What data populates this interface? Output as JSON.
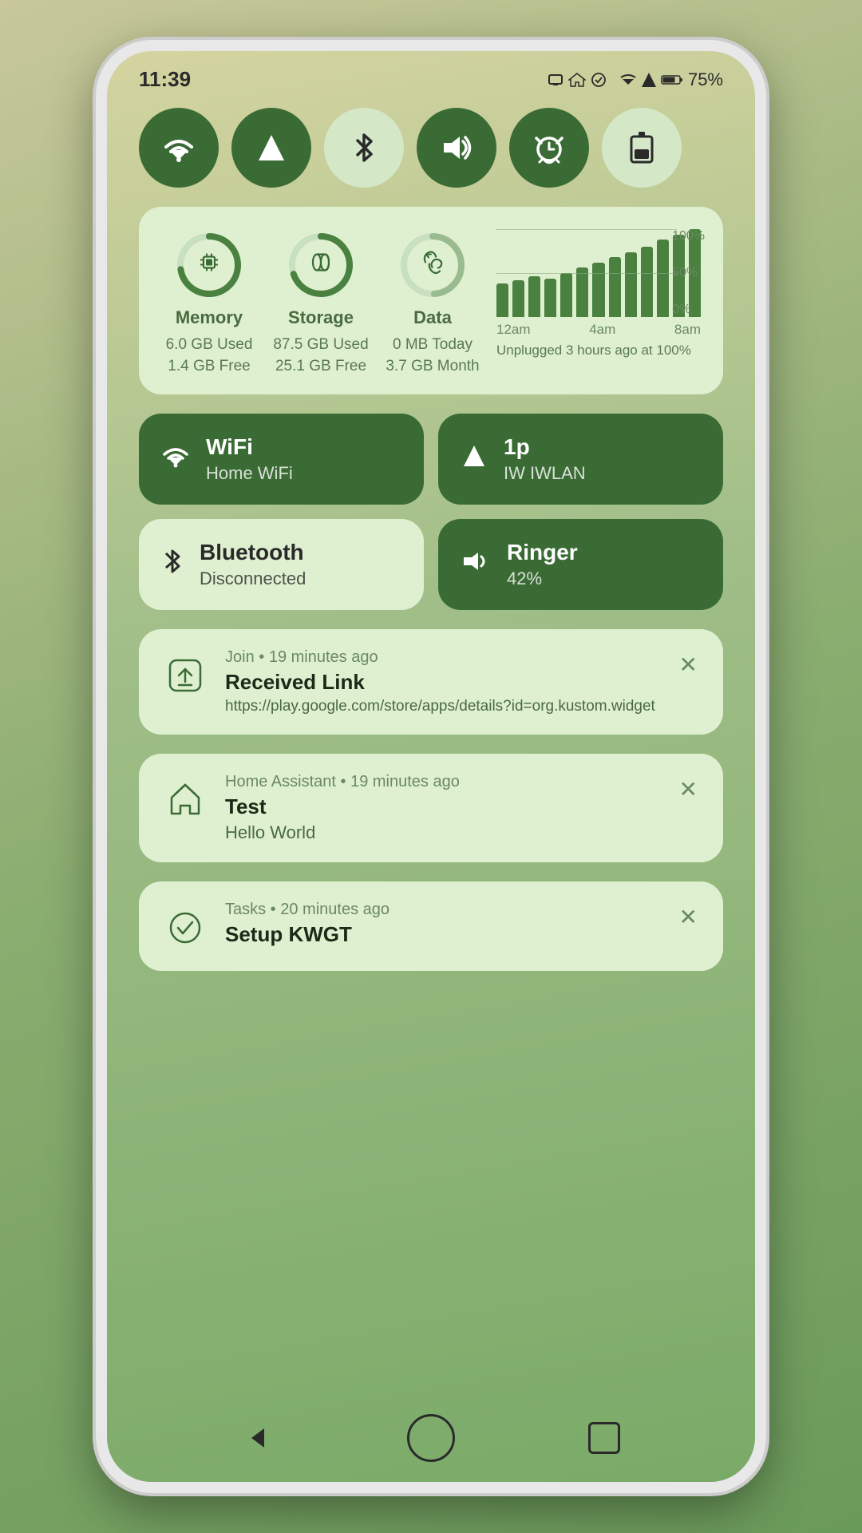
{
  "statusBar": {
    "time": "11:39",
    "battery": "75%",
    "batteryIcon": "🔋",
    "wifiIcon": "▼",
    "signalIcon": "▲"
  },
  "toggles": [
    {
      "id": "wifi",
      "icon": "wifi",
      "active": true,
      "label": "WiFi"
    },
    {
      "id": "signal",
      "icon": "signal",
      "active": true,
      "label": "Signal"
    },
    {
      "id": "bluetooth",
      "icon": "bluetooth",
      "active": false,
      "label": "Bluetooth"
    },
    {
      "id": "sound",
      "icon": "sound",
      "active": true,
      "label": "Sound"
    },
    {
      "id": "alarm",
      "icon": "alarm",
      "active": true,
      "label": "Alarm"
    },
    {
      "id": "battery",
      "icon": "battery",
      "active": true,
      "label": "Battery"
    }
  ],
  "stats": {
    "memory": {
      "label": "Memory",
      "used": "6.0 GB Used",
      "free": "1.4 GB Free",
      "percent": 81
    },
    "storage": {
      "label": "Storage",
      "used": "87.5 GB Used",
      "free": "25.1 GB Free",
      "percent": 78
    },
    "data": {
      "label": "Data",
      "used": "0 MB Today",
      "free": "3.7 GB Month",
      "percent": 55
    },
    "chart": {
      "bars": [
        40,
        45,
        50,
        48,
        55,
        60,
        65,
        70,
        75,
        80,
        85,
        90,
        95
      ],
      "xLabels": [
        "12am",
        "4am",
        "8am"
      ],
      "yLabels": [
        "100%",
        "50%",
        "0%"
      ],
      "unplugged": "Unplugged 3 hours ago at 100%"
    }
  },
  "controls": [
    {
      "id": "wifi-tile",
      "title": "WiFi",
      "subtitle": "Home WiFi",
      "active": true,
      "icon": "wifi"
    },
    {
      "id": "signal-tile",
      "title": "1p",
      "subtitle": "IW IWLAN",
      "active": true,
      "icon": "signal"
    },
    {
      "id": "bluetooth-tile",
      "title": "Bluetooth",
      "subtitle": "Disconnected",
      "active": false,
      "icon": "bluetooth"
    },
    {
      "id": "ringer-tile",
      "title": "Ringer",
      "subtitle": "42%",
      "active": true,
      "icon": "ringer"
    }
  ],
  "notifications": [
    {
      "id": "join-notif",
      "app": "Join",
      "time": "19 minutes ago",
      "title": "Received Link",
      "body": "https://play.google.com/store/apps/details?id=org.kustom.widget",
      "icon": "join"
    },
    {
      "id": "ha-notif",
      "app": "Home Assistant",
      "time": "19 minutes ago",
      "title": "Test",
      "body": "Hello World",
      "icon": "home-assistant"
    },
    {
      "id": "tasks-notif",
      "app": "Tasks",
      "time": "20 minutes ago",
      "title": "Setup KWGT",
      "body": "",
      "icon": "tasks"
    }
  ],
  "navbar": {
    "back": "◀",
    "home": "",
    "recent": ""
  }
}
